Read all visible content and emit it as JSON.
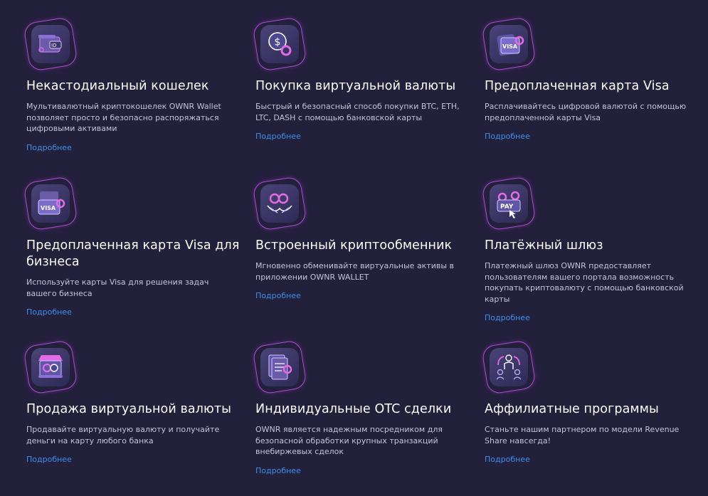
{
  "features": [
    {
      "icon": "wallet-icon",
      "title": "Некастодиальный кошелек",
      "desc": "Мультивалютный криптокошелек OWNR Wallet позволяет просто и безопасно распоряжаться цифровыми активами",
      "link": "Подробнее"
    },
    {
      "icon": "coin-dollar-icon",
      "title": "Покупка виртуальной валюты",
      "desc": "Быстрый и безопасный способ покупки BTC, ETH, LTC, DASH с помощью банковской карты",
      "link": "Подробнее"
    },
    {
      "icon": "visa-card-icon",
      "icon_text": "VISA",
      "title": "Предоплаченная карта Visa",
      "desc": "Расплачивайтесь цифровой валютой с помощью предоплаченной карты Visa",
      "link": "Подробнее"
    },
    {
      "icon": "business-visa-card-icon",
      "icon_text": "VISA",
      "title": "Предоплаченная карта Visa для бизнеса",
      "desc": "Используйте карты Visa для решения задач вашего бизнеса",
      "link": "Подробнее"
    },
    {
      "icon": "crypto-exchange-icon",
      "title": "Встроенный криптообменник",
      "desc": "Мгновенно обменивайте виртуальные активы в приложении OWNR WALLET",
      "link": "Подробнее"
    },
    {
      "icon": "pay-gateway-icon",
      "icon_text": "PAY",
      "title": "Платёжный шлюз",
      "desc": "Платежный шлюз OWNR предоставляет пользователям вашего портала возможность покупать криптовалюту с помощью банковской карты",
      "link": "Подробнее"
    },
    {
      "icon": "store-sell-icon",
      "title": "Продажа виртуальной валюты",
      "desc": "Продавайте виртуальную валюту и получайте деньги на карту любого банка",
      "link": "Подробнее"
    },
    {
      "icon": "otc-document-icon",
      "title": "Индивидуальные OTC сделки",
      "desc": "OWNR является надежным посредником для безопасной обработки крупных транзакций внебиржевых сделок",
      "link": "Подробнее"
    },
    {
      "icon": "affiliate-people-icon",
      "title": "Аффилиатные программы",
      "desc": "Станьте нашим партнером по модели Revenue Share навсегда!",
      "link": "Подробнее"
    }
  ],
  "colors": {
    "background": "#23203c",
    "accent": "#b249d8",
    "link": "#3d8fe8"
  }
}
